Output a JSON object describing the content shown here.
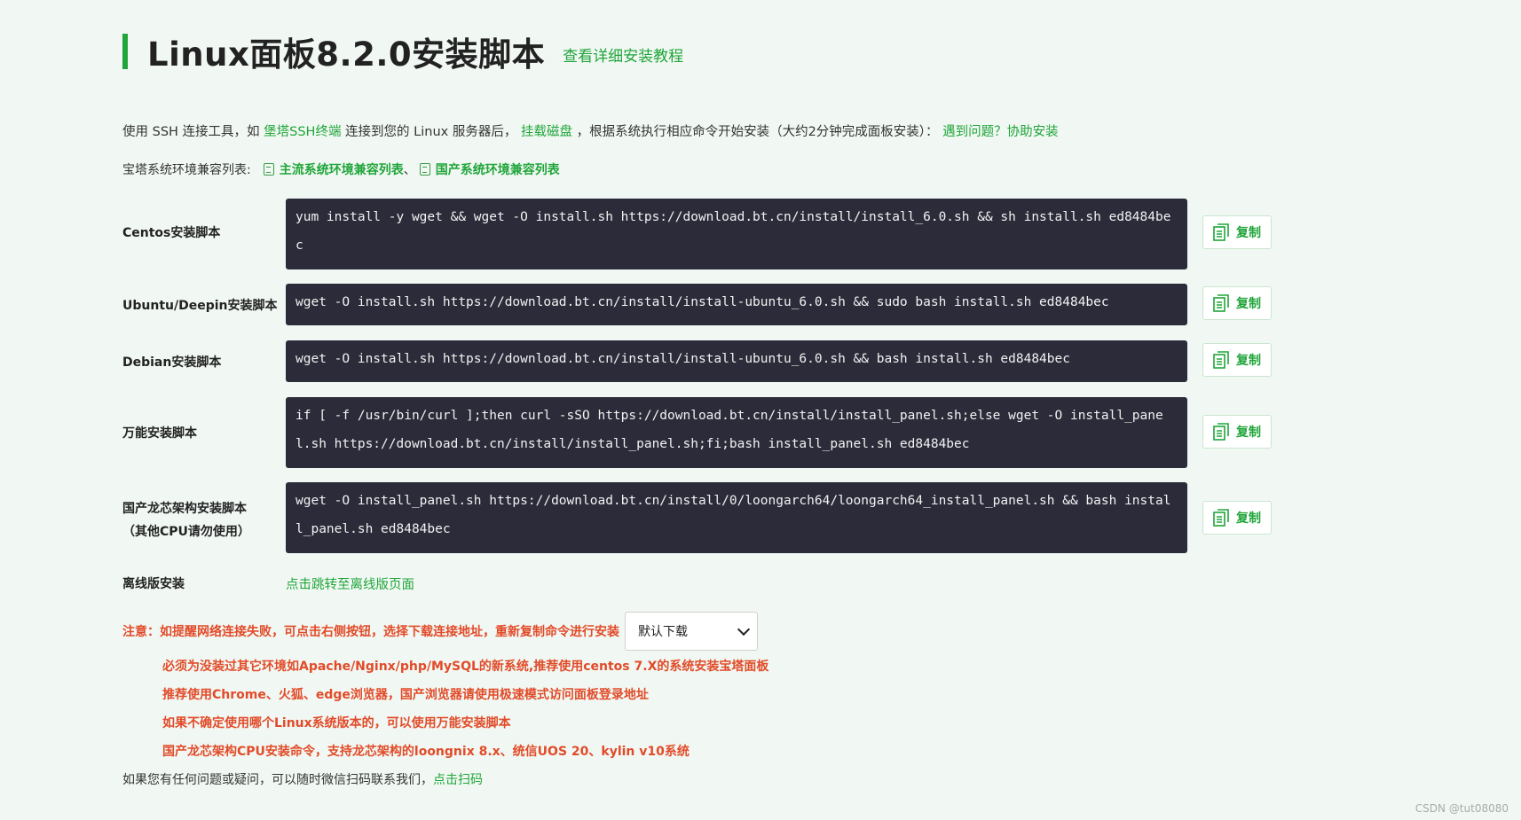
{
  "header": {
    "title": "Linux面板8.2.0安装脚本",
    "tutorial_link": "查看详细安装教程"
  },
  "intro": {
    "part1": "使用 SSH 连接工具，如 ",
    "ssh_link": "堡塔SSH终端",
    "part2": " 连接到您的 Linux 服务器后， ",
    "disk_link": "挂载磁盘",
    "part3": " ，根据系统执行相应命令开始安装（大约2分钟完成面板安装）： ",
    "help_link": "遇到问题？协助安装"
  },
  "compat": {
    "label": "宝塔系统环境兼容列表:",
    "mainstream_link": "主流系统环境兼容列表",
    "sep": "、",
    "domestic_link": "国产系统环境兼容列表"
  },
  "scripts": [
    {
      "label": "Centos安装脚本",
      "label2": "",
      "command": "yum install -y wget && wget -O install.sh https://download.bt.cn/install/install_6.0.sh && sh install.sh ed8484bec",
      "copy": "复制"
    },
    {
      "label": "Ubuntu/Deepin安装脚本",
      "label2": "",
      "command": "wget -O install.sh https://download.bt.cn/install/install-ubuntu_6.0.sh && sudo bash install.sh ed8484bec",
      "copy": "复制"
    },
    {
      "label": "Debian安装脚本",
      "label2": "",
      "command": "wget -O install.sh https://download.bt.cn/install/install-ubuntu_6.0.sh && bash install.sh ed8484bec",
      "copy": "复制"
    },
    {
      "label": "万能安装脚本",
      "label2": "",
      "command": "if [ -f /usr/bin/curl ];then curl -sSO https://download.bt.cn/install/install_panel.sh;else wget -O install_panel.sh https://download.bt.cn/install/install_panel.sh;fi;bash install_panel.sh ed8484bec",
      "copy": "复制"
    },
    {
      "label": "国产龙芯架构安装脚本",
      "label2": "（其他CPU请勿使用）",
      "command": "wget -O install_panel.sh https://download.bt.cn/install/0/loongarch64/loongarch64_install_panel.sh && bash install_panel.sh ed8484bec",
      "copy": "复制"
    }
  ],
  "offline": {
    "label": "离线版安装",
    "link": "点击跳转至离线版页面"
  },
  "notice": {
    "text": "注意：如提醒网络连接失败，可点击右侧按钮，选择下载连接地址，重新复制命令进行安装",
    "select_value": "默认下载"
  },
  "tips": [
    "必须为没装过其它环境如Apache/Nginx/php/MySQL的新系统,推荐使用centos 7.X的系统安装宝塔面板",
    "推荐使用Chrome、火狐、edge浏览器，国产浏览器请使用极速模式访问面板登录地址",
    "如果不确定使用哪个Linux系统版本的，可以使用万能安装脚本",
    "国产龙芯架构CPU安装命令，支持龙芯架构的loongnix 8.x、统信UOS 20、kylin v10系统"
  ],
  "footer": {
    "text": "如果您有任何问题或疑问，可以随时微信扫码联系我们，",
    "link": "点击扫码"
  },
  "watermark": "CSDN @tut08080",
  "colors": {
    "accent": "#20a53a",
    "warning": "#e24b29",
    "code_bg": "#2b2b3a",
    "page_bg": "#f1f8f3"
  }
}
